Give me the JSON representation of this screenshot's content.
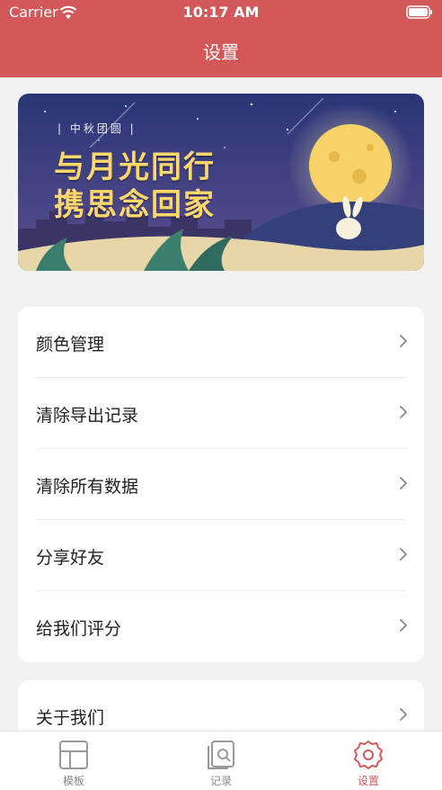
{
  "status_bar": {
    "carrier": "Carrier",
    "time": "10:17 AM"
  },
  "header": {
    "title": "设置"
  },
  "banner": {
    "tag": "| 中秋团圆 |",
    "line1": "与月光同行",
    "line2": "携思念回家"
  },
  "menu_group1": [
    {
      "label": "颜色管理"
    },
    {
      "label": "清除导出记录"
    },
    {
      "label": "清除所有数据"
    },
    {
      "label": "分享好友"
    },
    {
      "label": "给我们评分"
    }
  ],
  "menu_group2": [
    {
      "label": "关于我们"
    }
  ],
  "tabbar": {
    "tabs": [
      {
        "label": "模板",
        "icon": "template-icon",
        "active": false
      },
      {
        "label": "记录",
        "icon": "record-icon",
        "active": false
      },
      {
        "label": "设置",
        "icon": "gear-icon",
        "active": true
      }
    ]
  },
  "colors": {
    "accent": "#d3585a",
    "background": "#f2f2f2"
  }
}
